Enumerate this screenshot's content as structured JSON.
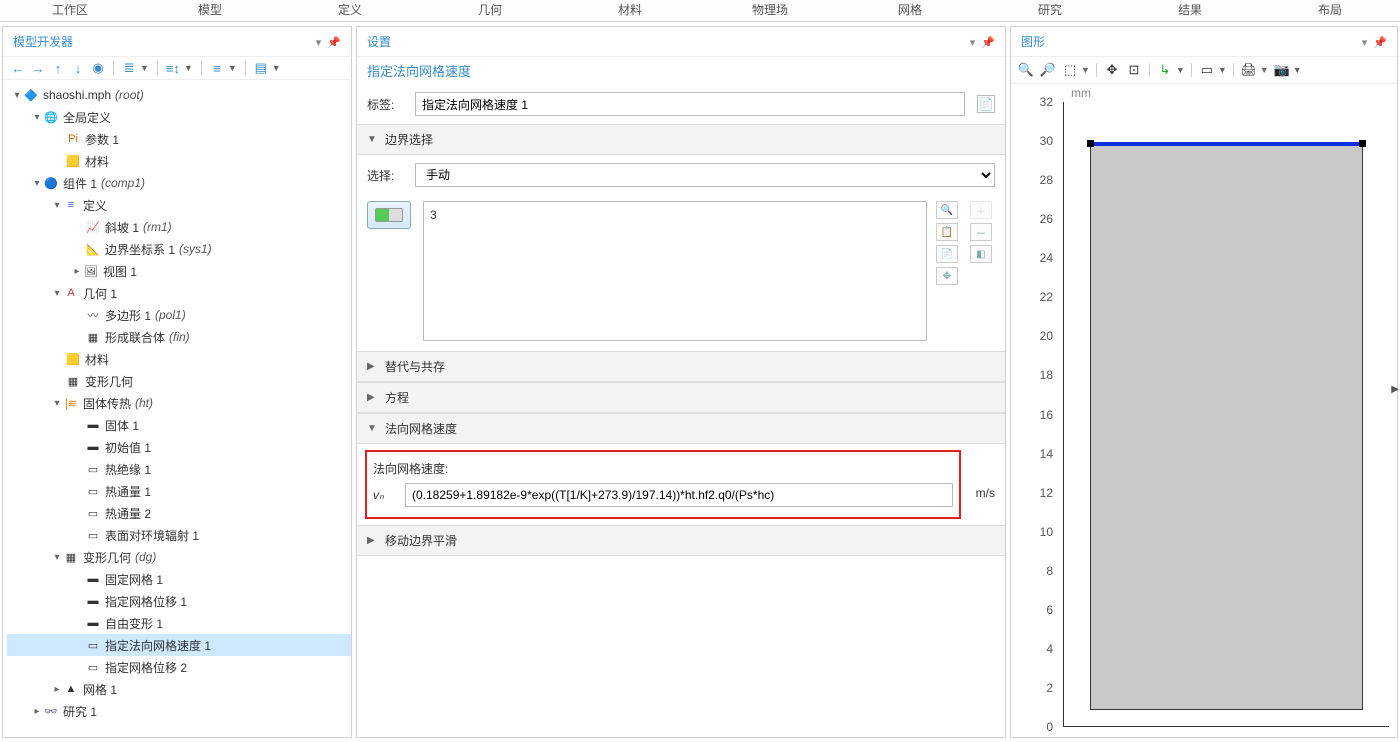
{
  "ribbon": [
    "工作区",
    "模型",
    "定义",
    "几何",
    "材料",
    "物理场",
    "网格",
    "研究",
    "结果",
    "布局"
  ],
  "model": {
    "title": "模型开发器",
    "root": {
      "label": "shaoshi.mph",
      "suffix": "(root)"
    },
    "globalDef": "全局定义",
    "params": "参数 1",
    "materials": "材料",
    "comp": {
      "label": "组件 1",
      "suffix": "(comp1)"
    },
    "def": "定义",
    "ramp": {
      "label": "斜坡 1",
      "suffix": "(rm1)"
    },
    "bcs": {
      "label": "边界坐标系 1",
      "suffix": "(sys1)"
    },
    "view": "视图 1",
    "geom": "几何 1",
    "poly": {
      "label": "多边形 1",
      "suffix": "(pol1)"
    },
    "union": {
      "label": "形成联合体",
      "suffix": "(fin)"
    },
    "materials2": "材料",
    "defgeom": "变形几何",
    "ht": {
      "label": "固体传热",
      "suffix": "(ht)"
    },
    "solid": "固体 1",
    "init": "初始值 1",
    "ins": "热绝缘 1",
    "hf1": "热通量 1",
    "hf2": "热通量 2",
    "rad": "表面对环境辐射 1",
    "dg": {
      "label": "变形几何",
      "suffix": "(dg)"
    },
    "fixed": "固定网格 1",
    "disp1": "指定网格位移 1",
    "free": "自由变形 1",
    "nvel": "指定法向网格速度 1",
    "disp2": "指定网格位移 2",
    "mesh": "网格 1",
    "study": "研究 1"
  },
  "settings": {
    "title": "设置",
    "subtitle": "指定法向网格速度",
    "labelTag": "标签:",
    "labelValue": "指定法向网格速度 1",
    "boundarySel": "边界选择",
    "selectLabel": "选择:",
    "selectValue": "手动",
    "listItem": "3",
    "override": "替代与共存",
    "equation": "方程",
    "normalVel": "法向网格速度",
    "fieldLabel": "法向网格速度:",
    "vnSym": "vₙ",
    "vnValue": "(0.18259+1.89182e-9*exp((T[1/K]+273.9)/197.14))*ht.hf2.q0/(Ps*hc)",
    "unit": "m/s",
    "smooth": "移动边界平滑"
  },
  "graph": {
    "title": "图形",
    "mm": "mm",
    "yticks": [
      32,
      30,
      28,
      26,
      24,
      22,
      20,
      18,
      16,
      14,
      12,
      10,
      8,
      6,
      4,
      2,
      0
    ]
  }
}
